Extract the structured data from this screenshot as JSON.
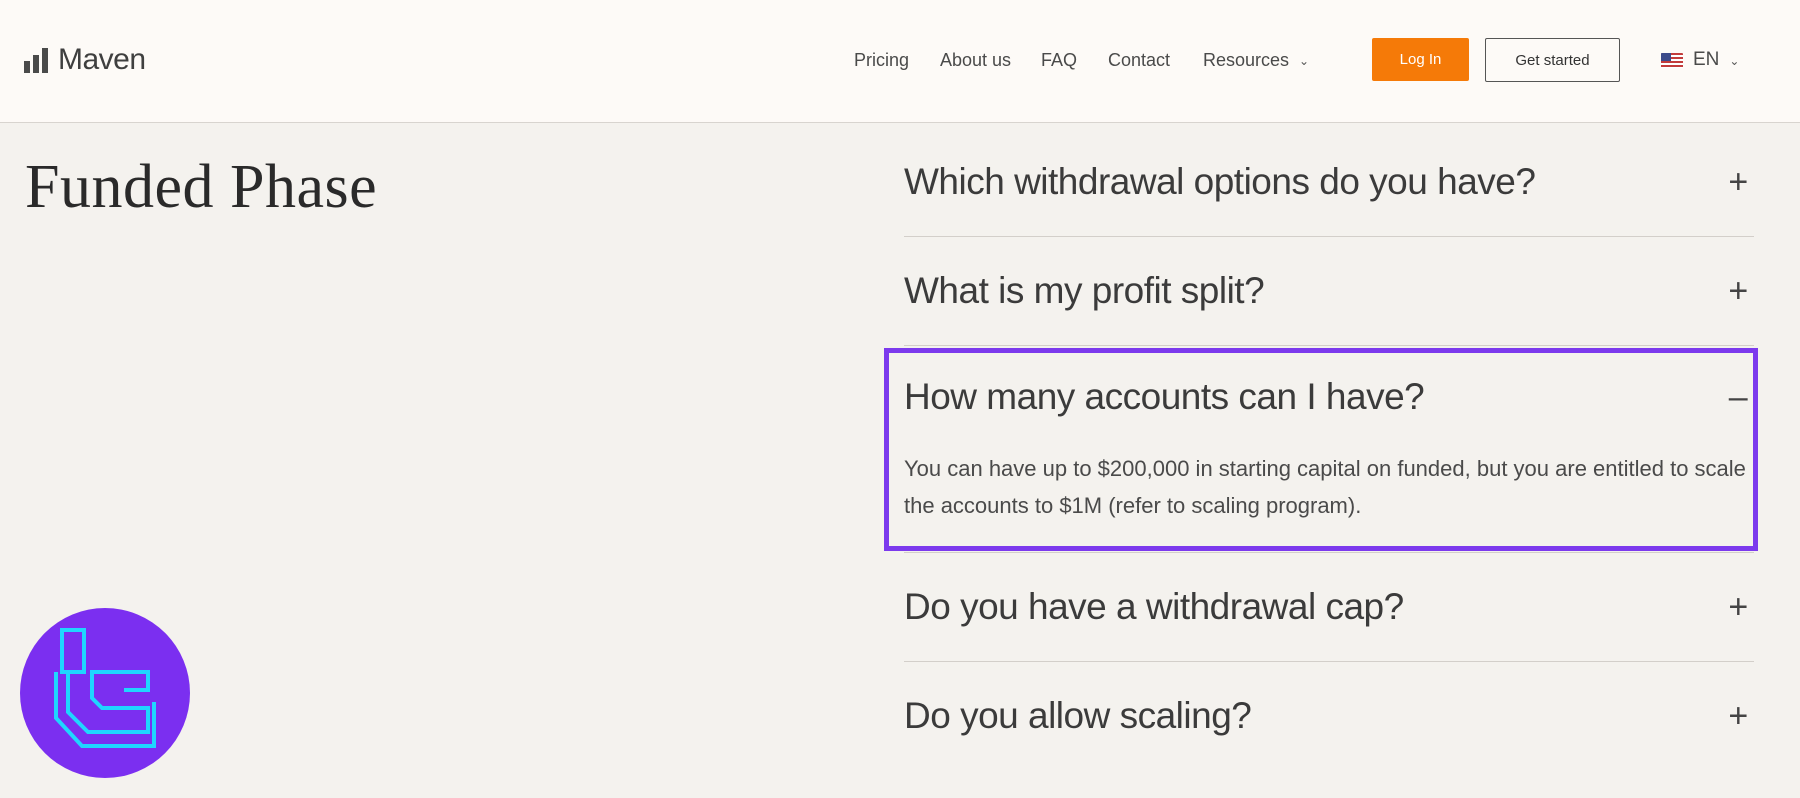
{
  "header": {
    "logo_text": "Maven",
    "nav": {
      "pricing": "Pricing",
      "about": "About us",
      "faq": "FAQ",
      "contact": "Contact",
      "resources": "Resources"
    },
    "login_label": "Log In",
    "get_started_label": "Get started",
    "language": "EN"
  },
  "colors": {
    "accent_orange": "#f57a08",
    "highlight_purple": "#7c3aed",
    "badge_purple": "#7b2ff0",
    "badge_cyan": "#1fd6ff"
  },
  "section": {
    "title": "Funded Phase"
  },
  "faq": {
    "items": [
      {
        "question": "Which withdrawal options do you have?",
        "toggle": "+"
      },
      {
        "question": "What is my profit split?",
        "toggle": "+"
      },
      {
        "question": "How many accounts can I have?",
        "toggle": "–",
        "answer": "You can have up to $200,000 in starting capital on funded, but you are entitled to scale the accounts to $1M (refer to scaling program)."
      },
      {
        "question": "Do you have a withdrawal cap?",
        "toggle": "+"
      },
      {
        "question": "Do you allow scaling?",
        "toggle": "+"
      }
    ]
  },
  "icons": {
    "logo": "bar-chart-logo-icon",
    "chevron": "chevron-down-icon",
    "flag": "us-flag-icon",
    "watermark": "tc-badge-icon"
  }
}
